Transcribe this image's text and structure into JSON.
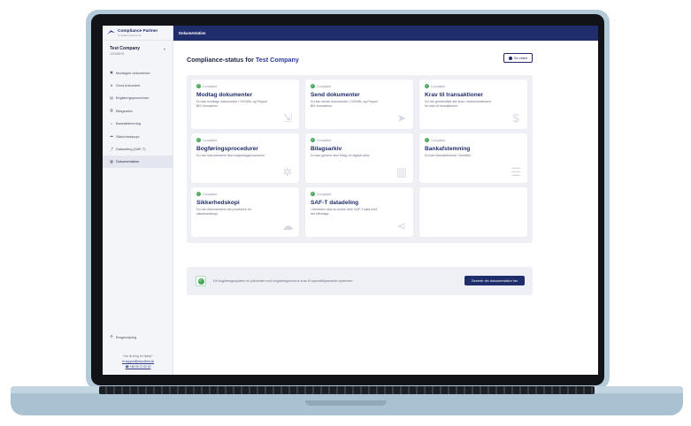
{
  "app": {
    "brand_name": "Compliance Partner",
    "brand_sub": "compliancepartner.dk"
  },
  "sidebar": {
    "company_name": "Test Company",
    "company_id": "12345678",
    "items": [
      {
        "label": "Modtagne dokumenter",
        "icon": "inbox-icon"
      },
      {
        "label": "Send dokument",
        "icon": "send-icon"
      },
      {
        "label": "Bogføringsprocedurer",
        "icon": "book-icon"
      },
      {
        "label": "Bilagsarkiv",
        "icon": "archive-icon"
      },
      {
        "label": "Bankafstemning",
        "icon": "bank-icon"
      },
      {
        "label": "Sikkerhedskopi",
        "icon": "cloud-icon"
      },
      {
        "label": "Datadeling (SAF-T)",
        "icon": "share-icon"
      },
      {
        "label": "Dokumentation",
        "icon": "document-icon"
      }
    ],
    "active_index": 7,
    "settings_label": "Brugerstyring",
    "help_title": "Har du brug for hjælp?",
    "help_email": "support@cloudfree.dk",
    "help_phone": "+45 00 72 00 00"
  },
  "topbar": {
    "title": "Dokumentation"
  },
  "header": {
    "title_prefix": "Compliance-status for",
    "company": "Test Company",
    "video_button": "Se video"
  },
  "cards": [
    {
      "status": "Compliant",
      "title": "Modtag dokumenter",
      "desc": "Du kan modtage dokumenter i OIOUBL og Peppol BIS formaterne.",
      "icon": "download-icon"
    },
    {
      "status": "Compliant",
      "title": "Send dokumenter",
      "desc": "Du kan sende dokumenter i OIOUBL og Peppol BIS formaterne.",
      "icon": "send-icon"
    },
    {
      "status": "Compliant",
      "title": "Krav til transaktioner",
      "desc": "Du har gennemført alle krav i dokumentationen for krav til transaktioner.",
      "icon": "coin-icon"
    },
    {
      "status": "Compliant",
      "title": "Bogføringsprocedurer",
      "desc": "Du har dokumenteret dine bogføringsprocedurer.",
      "icon": "network-icon"
    },
    {
      "status": "Compliant",
      "title": "Bilagsarkiv",
      "desc": "Du kan gemme dine bilag i et digitalt arkiv.",
      "icon": "barcode-icon"
    },
    {
      "status": "Compliant",
      "title": "Bankafstemning",
      "desc": "Du kan bankafstemme i formålet.",
      "icon": "list-icon"
    },
    {
      "status": "Compliant",
      "title": "Sikkerhedskopi",
      "desc": "Du har dokumenteret din procedure for sikkerhedskopi.",
      "icon": "cloud-upload-icon"
    },
    {
      "status": "Compliant",
      "title": "SAF-T datadeling",
      "desc": "I fremtiden skal du kunne dele SAF-T data med det offentlige.",
      "icon": "share-icon"
    }
  ],
  "banner": {
    "text": "Dit bogføringssystem er påmindet med bogføringslovens krav til specialtilpassede systemer.",
    "button": "Generér din dokumentation her"
  },
  "colors": {
    "navy": "#1f2d6b",
    "compliant_green": "#46a85a"
  }
}
